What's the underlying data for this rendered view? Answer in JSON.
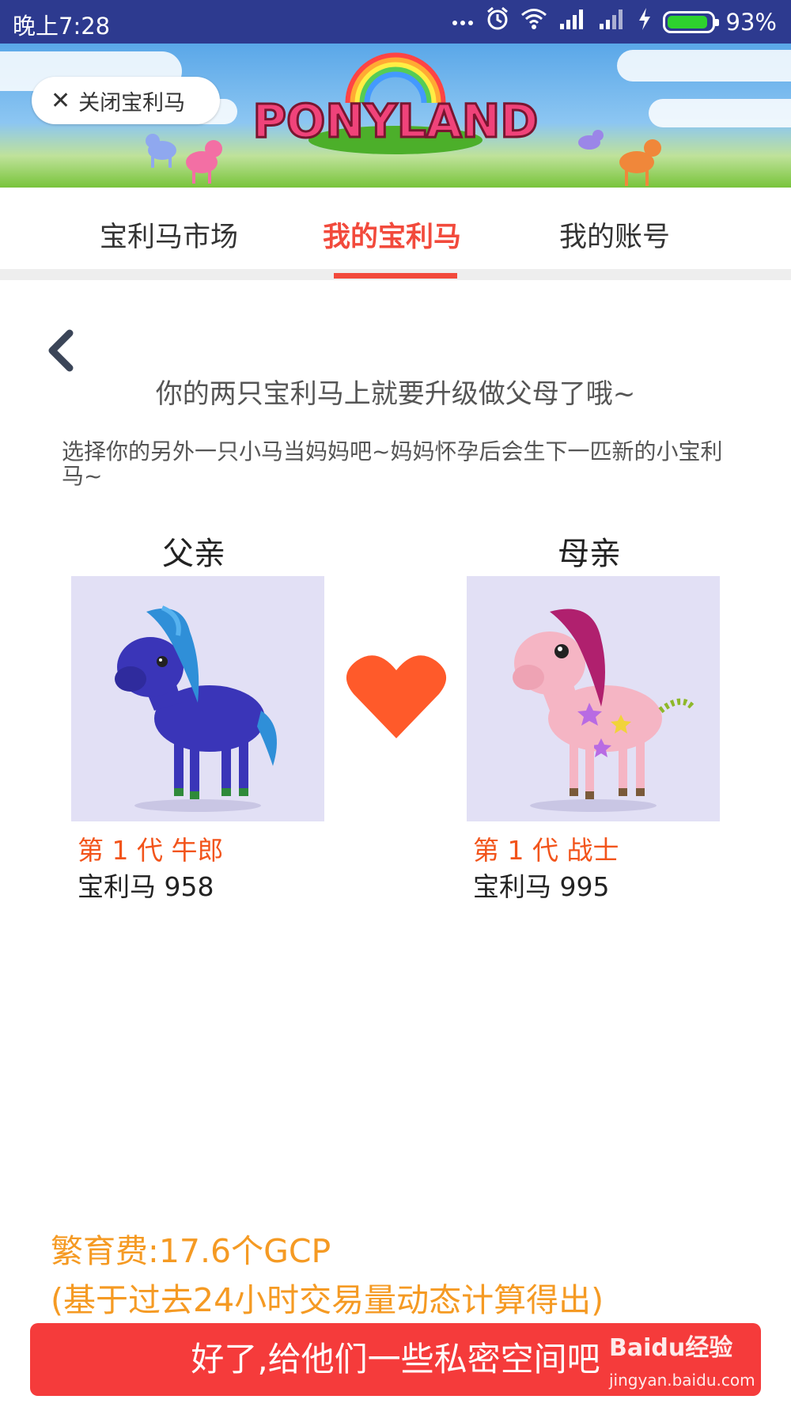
{
  "status_bar": {
    "time": "晚上7:28",
    "battery_percent": "93%",
    "battery_level": 0.93
  },
  "banner": {
    "close_label": "关闭宝利马",
    "logo_text": "PONYLAND"
  },
  "tabs": [
    {
      "label": "宝利马市场",
      "active": false
    },
    {
      "label": "我的宝利马",
      "active": true
    },
    {
      "label": "我的账号",
      "active": false
    }
  ],
  "content": {
    "headline": "你的两只宝利马上就要升级做父母了哦~",
    "description": "选择你的另外一只小马当妈妈吧~妈妈怀孕后会生下一匹新的小宝利马~",
    "father": {
      "role": "父亲",
      "generation": "第 1 代 牛郎",
      "name": "宝利马 958",
      "color": "#3a35b8"
    },
    "mother": {
      "role": "母亲",
      "generation": "第 1 代 战士",
      "name": "宝利马 995",
      "color": "#f5b5c4"
    }
  },
  "fee": {
    "line1": "繁育费:17.6个GCP",
    "line2": "(基于过去24小时交易量动态计算得出)"
  },
  "cta_label": "好了,给他们一些私密空间吧",
  "watermark": {
    "main": "Baidu经验",
    "sub": "jingyan.baidu.com"
  },
  "colors": {
    "accent": "#f24a3c",
    "status_bar": "#2d3a8f",
    "fee_text": "#f59a23",
    "generation_text": "#f2541b",
    "cta_bg": "#f53b3b",
    "pony_card_bg": "#e2e0f5",
    "heart": "#ff5a2a"
  },
  "icons": [
    "dots-icon",
    "alarm-icon",
    "wifi-icon",
    "signal-icon",
    "charging-icon",
    "battery-icon",
    "close-icon",
    "back-chevron-icon",
    "heart-icon"
  ]
}
